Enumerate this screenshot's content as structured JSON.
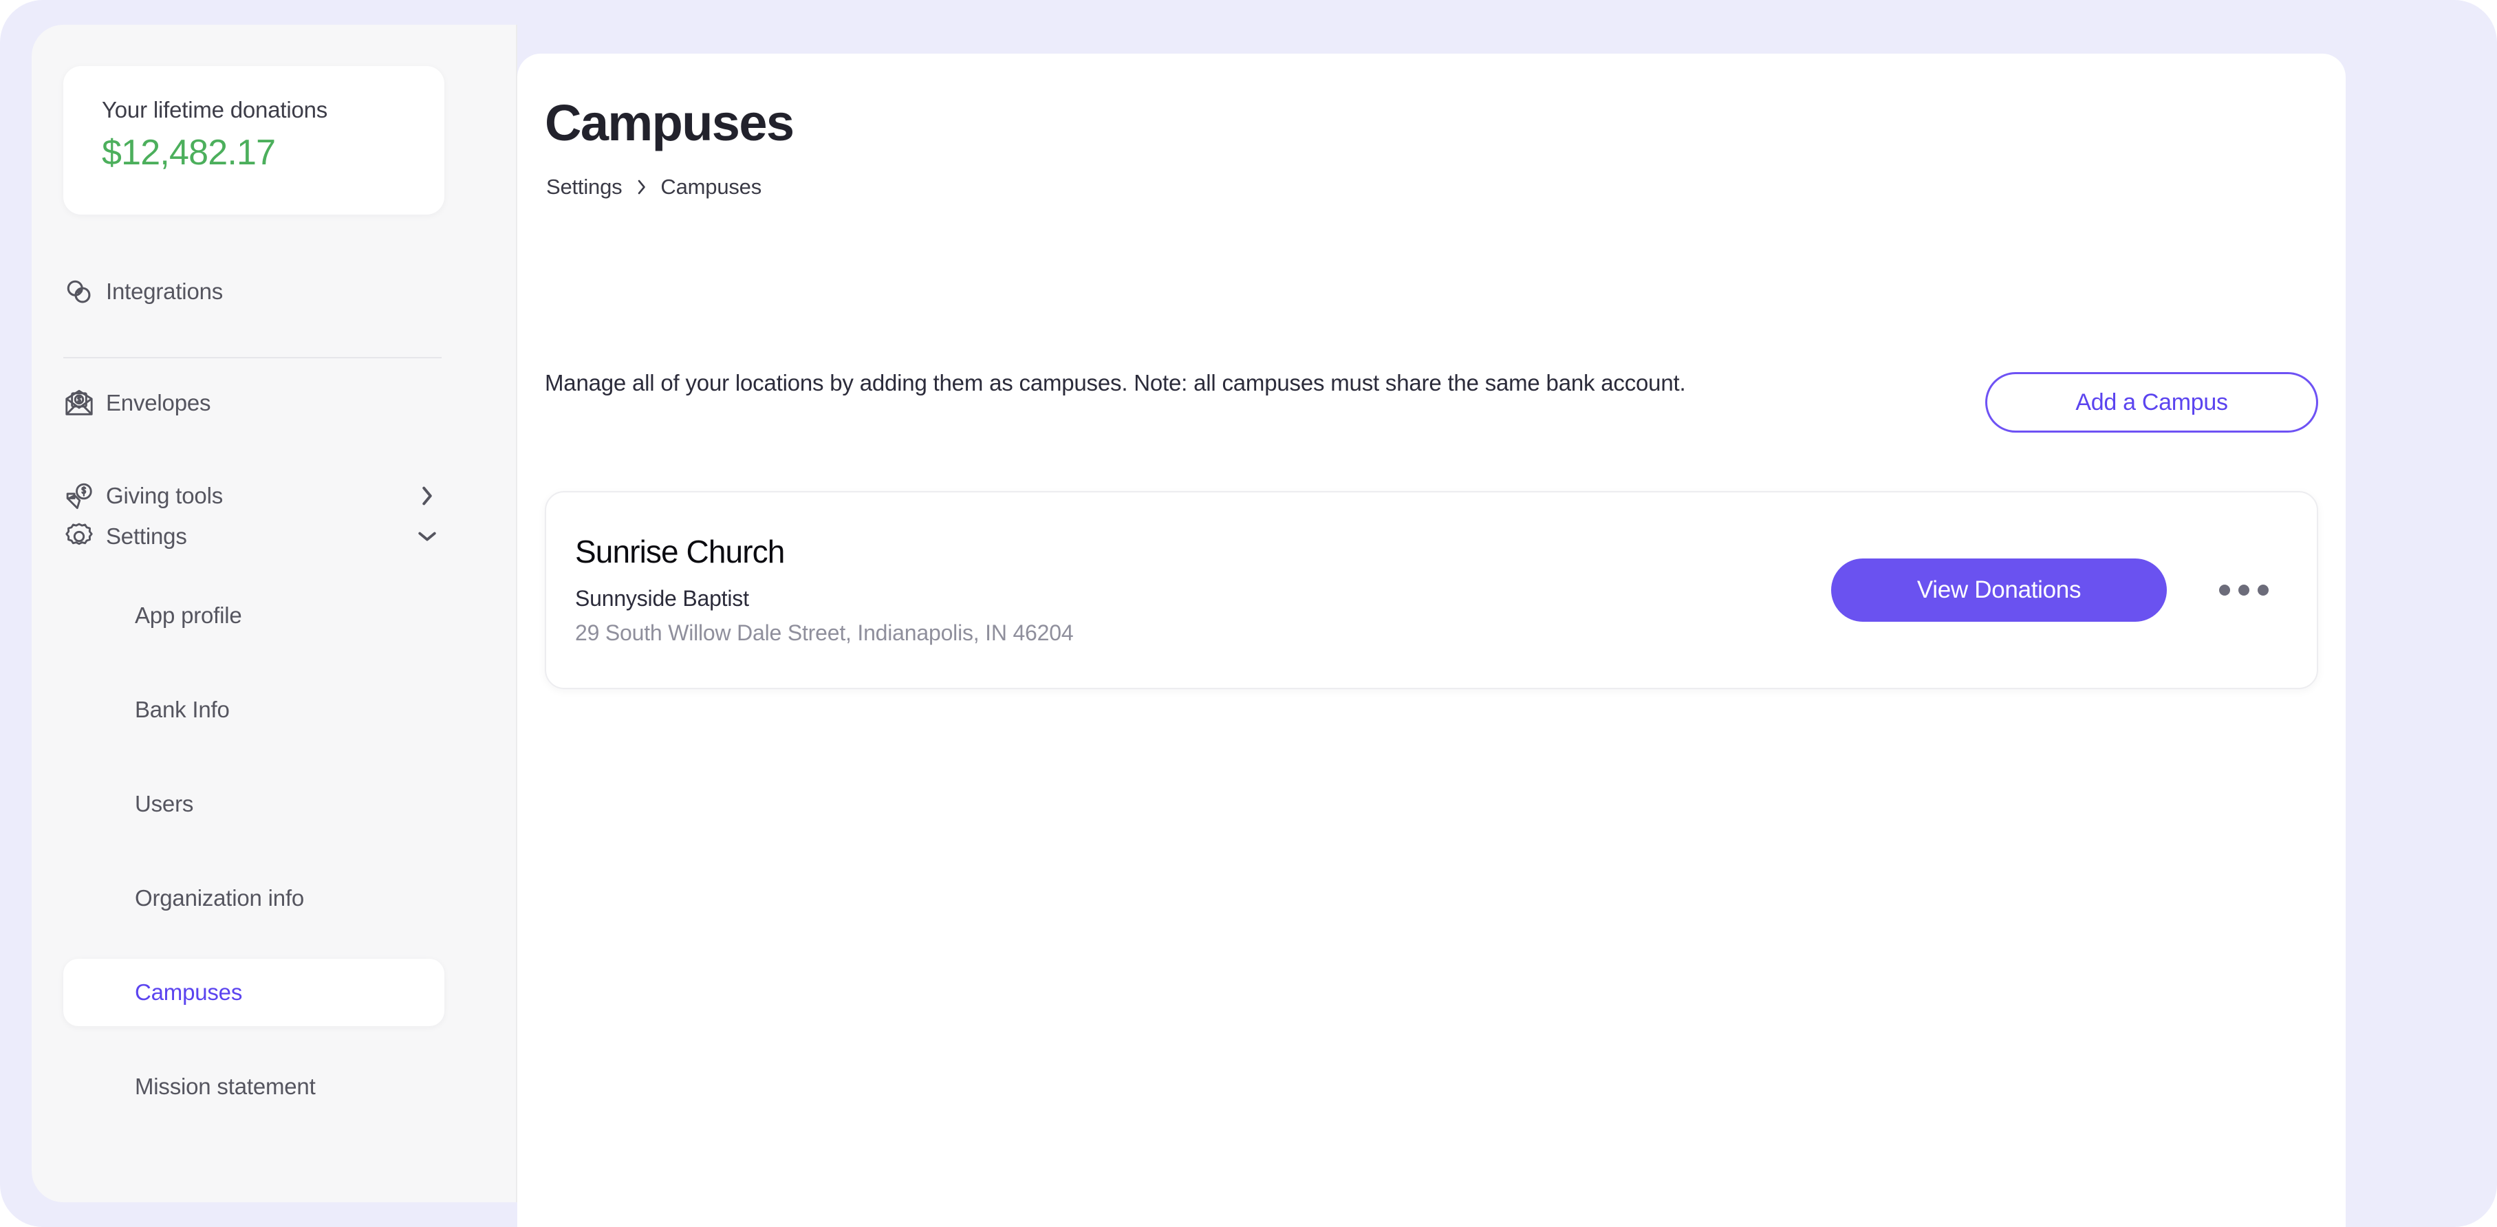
{
  "sidebar": {
    "donation_card": {
      "label": "Your lifetime donations",
      "amount": "$12,482.17",
      "amount_color": "#4caf5c"
    },
    "nav_items": [
      {
        "label": "Integrations",
        "icon": "integrations-icon",
        "chevron": ""
      },
      {
        "label": "Envelopes",
        "icon": "envelope-dollar-icon",
        "chevron": ""
      },
      {
        "label": "Giving tools",
        "icon": "giving-tools-icon",
        "chevron": "chevron-right-icon"
      },
      {
        "label": "Settings",
        "icon": "gear-icon",
        "chevron": "chevron-down-icon"
      }
    ],
    "sub_items": [
      {
        "label": "App profile",
        "active": false
      },
      {
        "label": "Bank Info",
        "active": false
      },
      {
        "label": "Users",
        "active": false
      },
      {
        "label": "Organization info",
        "active": false
      },
      {
        "label": "Campuses",
        "active": true
      },
      {
        "label": "Mission statement",
        "active": false
      }
    ],
    "active_color": "#5b44ef"
  },
  "main": {
    "title": "Campuses",
    "breadcrumb": {
      "parent": "Settings",
      "separator": "›",
      "current": "Campuses"
    },
    "description": "Manage all of your locations by adding them as campuses. Note: all campuses must share the same bank account.",
    "add_campus_label": "Add a Campus",
    "accent_color": "#6a52f0",
    "campuses": [
      {
        "name": "Sunrise Church",
        "organization": "Sunnyside Baptist",
        "address": "29 South Willow Dale Street, Indianapolis, IN 46204",
        "view_donations_label": "View Donations",
        "more_menu_icon": "more-horizontal-icon"
      }
    ]
  }
}
